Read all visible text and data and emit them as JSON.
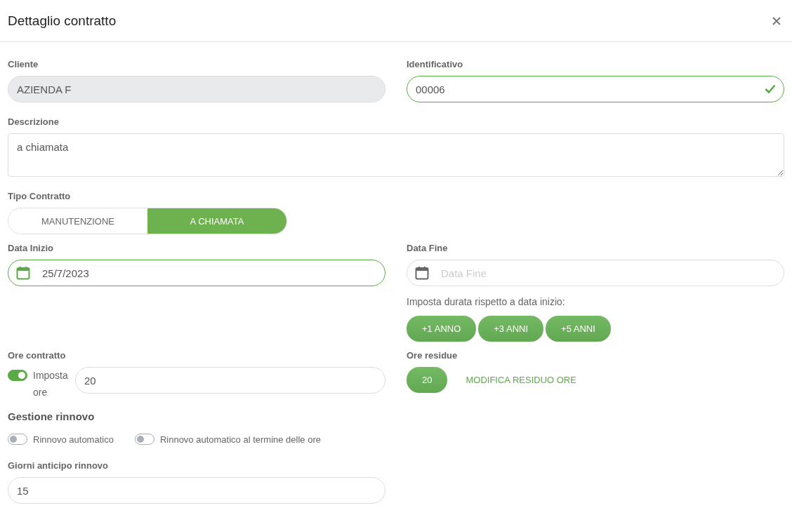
{
  "window": {
    "title": "Dettaglio contratto"
  },
  "cliente": {
    "label": "Cliente",
    "value": "AZIENDA F",
    "disabled": true
  },
  "identificativo": {
    "label": "Identificativo",
    "value": "00006",
    "valid": true
  },
  "descrizione": {
    "label": "Descrizione",
    "value": "a chiamata"
  },
  "tipo_contratto": {
    "label": "Tipo Contratto",
    "options": [
      {
        "label": "MANUTENZIONE",
        "selected": false
      },
      {
        "label": "A CHIAMATA",
        "selected": true
      }
    ]
  },
  "data_inizio": {
    "label": "Data Inizio",
    "value": "25/7/2023",
    "valid": true
  },
  "data_fine": {
    "label": "Data Fine",
    "placeholder": "Data Fine",
    "valid": false
  },
  "durata": {
    "label": "Imposta durata rispetto a data inizio:",
    "buttons": [
      "+1 ANNO",
      "+3 ANNI",
      "+5 ANNI"
    ]
  },
  "ore_contratto": {
    "label": "Ore contratto",
    "toggle_label": "Imposta ore",
    "on": true,
    "value": "20"
  },
  "ore_residue": {
    "label": "Ore residue",
    "value": "20",
    "link": "MODIFICA RESIDUO ORE"
  },
  "gestione_rinnovo": {
    "title": "Gestione rinnovo",
    "toggles": [
      {
        "label": "Rinnovo automatico",
        "on": false
      },
      {
        "label": "Rinnovo automatico al termine delle ore",
        "on": false
      }
    ]
  },
  "giorni_anticipo": {
    "label": "Giorni anticipo rinnovo",
    "value": "15"
  }
}
